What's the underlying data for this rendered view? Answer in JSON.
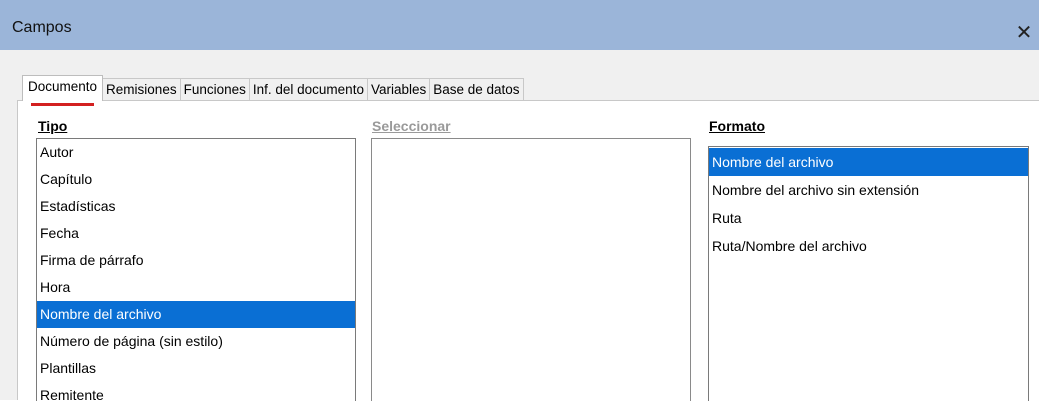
{
  "window": {
    "title": "Campos",
    "close_glyph": "✕"
  },
  "tabs": [
    {
      "label": "Documento",
      "active": true
    },
    {
      "label": "Remisiones",
      "active": false
    },
    {
      "label": "Funciones",
      "active": false
    },
    {
      "label": "Inf. del documento",
      "active": false
    },
    {
      "label": "Variables",
      "active": false
    },
    {
      "label": "Base de datos",
      "active": false
    }
  ],
  "tipo": {
    "label": "Tipo",
    "items": [
      "Autor",
      "Capítulo",
      "Estadísticas",
      "Fecha",
      "Firma de párrafo",
      "Hora",
      "Nombre del archivo",
      "Número de página (sin estilo)",
      "Plantillas",
      "Remitente"
    ],
    "selected": "Nombre del archivo"
  },
  "seleccionar": {
    "label": "Seleccionar",
    "enabled": false,
    "items": []
  },
  "formato": {
    "label": "Formato",
    "items": [
      "Nombre del archivo",
      "Nombre del archivo sin extensión",
      "Ruta",
      "Ruta/Nombre del archivo"
    ],
    "selected": "Nombre del archivo"
  },
  "colors": {
    "titlebar": "#9bb5d9",
    "selection": "#0a6fd4",
    "tab_indicator": "#d32020"
  }
}
